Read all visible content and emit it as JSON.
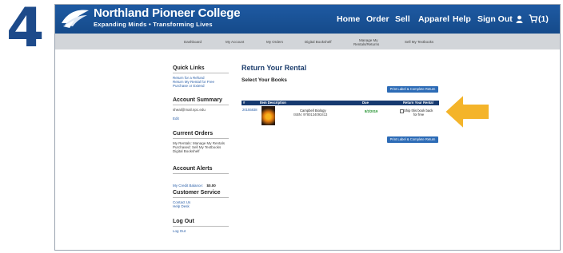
{
  "step": "4",
  "header": {
    "college_name": "Northland Pioneer College",
    "tagline": "Expanding Minds • Transforming Lives",
    "nav": {
      "home": "Home",
      "order": "Order",
      "sell": "Sell",
      "apparel": "Apparel",
      "help": "Help",
      "sign_out": "Sign Out",
      "cart": "(1)"
    }
  },
  "subnav": {
    "dashboard": "Dashboard",
    "my_account": "My Account",
    "my_orders": "My Orders",
    "digital_bookshelf": "Digital Bookshelf",
    "manage_rentals_line1": "Manage My",
    "manage_rentals_line2": "Rentals/Returns",
    "sell_textbooks": "Sell My Textbooks"
  },
  "sidebar": {
    "quick_links": {
      "title": "Quick Links",
      "links": [
        "Return for a Refund",
        "Return My Rental for Free",
        "Purchase or Extend"
      ]
    },
    "account_summary": {
      "title": "Account Summary",
      "email": "sheal@mail.npc.edu",
      "edit": "Edit"
    },
    "current_orders": {
      "title": "Current Orders",
      "rentals": "My Rentals: Manage My Rentals",
      "purchased": "Purchased: Sell My Textbooks",
      "digital": "Digital Bookshelf"
    },
    "account_alerts": {
      "title": "Account Alerts",
      "credit_label": "My Credit Balance:",
      "credit_value": "$0.00"
    },
    "customer_service": {
      "title": "Customer Service",
      "contact": "Contact Us",
      "help": "Help Desk"
    },
    "log_out": {
      "title": "Log Out",
      "link": "Log Out"
    }
  },
  "main": {
    "title": "Return Your Rental",
    "subtitle": "Select Your Books",
    "button_label": "Print Label & Complete Return",
    "table": {
      "columns": [
        "#",
        "Item Description",
        "Due",
        "Return Your Rental"
      ],
      "rows": [
        {
          "order_number": "20155838",
          "title": "Campbell Biology",
          "isbn": "ISBN: 9780134093413",
          "due": "8/2/2019",
          "return_line1": "Ship this book back",
          "return_line2": "for free"
        }
      ]
    }
  },
  "colors": {
    "header_blue": "#1a5296",
    "table_header": "#163a70",
    "link_blue": "#2a5fa8",
    "due_green": "#1e8f2a",
    "arrow_yellow": "#f4b42a"
  }
}
